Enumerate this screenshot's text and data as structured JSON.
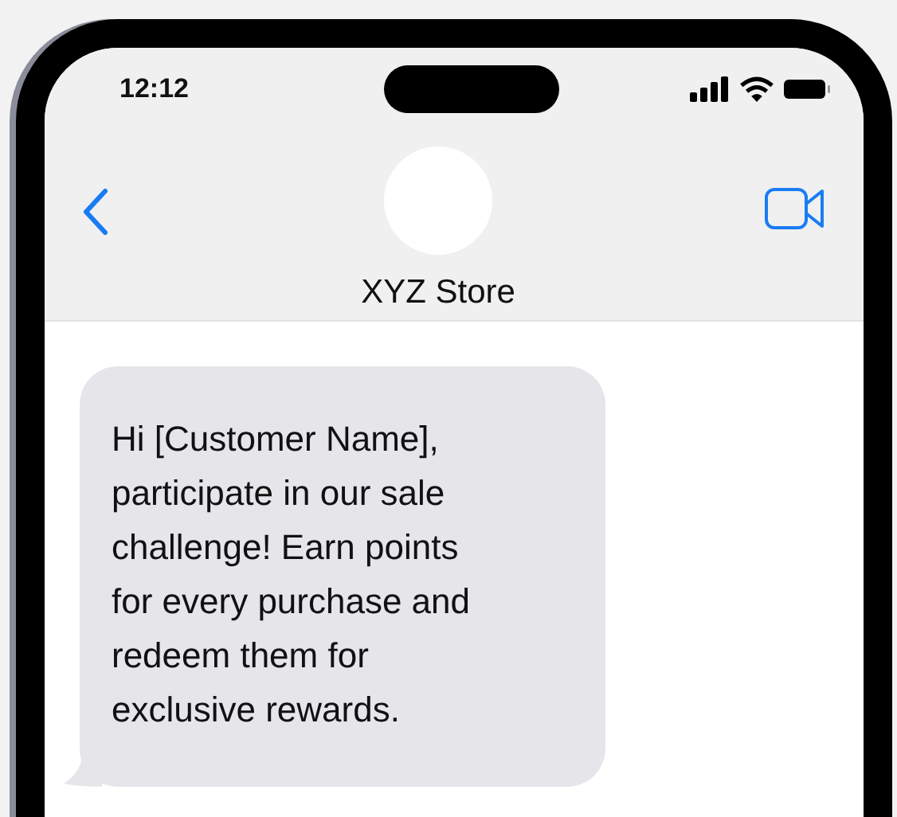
{
  "status_bar": {
    "time": "12:12"
  },
  "header": {
    "contact_name": "XYZ Store"
  },
  "messages": [
    {
      "text": "Hi [Customer Name], participate in our sale challenge! Earn points for every purchase and redeem them for exclusive rewards."
    }
  ]
}
